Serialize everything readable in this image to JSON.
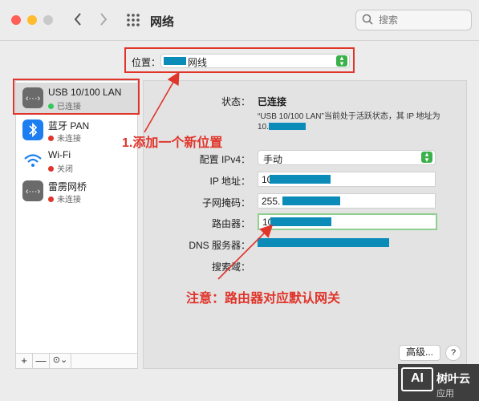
{
  "window": {
    "title": "网络"
  },
  "search": {
    "placeholder": "搜索"
  },
  "location": {
    "label": "位置：",
    "value": "网线"
  },
  "sidebar": {
    "services": [
      {
        "name": "USB 10/100 LAN",
        "status": "已连接",
        "status_color": "#34c759"
      },
      {
        "name": "蓝牙 PAN",
        "status": "未连接",
        "status_color": "#e0352b"
      },
      {
        "name": "Wi-Fi",
        "status": "关闭",
        "status_color": "#e0352b"
      },
      {
        "name": "雷雳网桥",
        "status": "未连接",
        "status_color": "#e0352b"
      }
    ],
    "footer": {
      "add": "+",
      "remove": "—",
      "actions": "⊙⌄"
    }
  },
  "detail": {
    "status_label": "状态：",
    "status_value": "已连接",
    "description": "“USB 10/100 LAN”当前处于活跃状态，其 IP 地址为 10.",
    "configure_label": "配置 IPv4：",
    "configure_value": "手动",
    "ip_label": "IP 地址：",
    "ip_value": "10",
    "subnet_label": "子网掩码：",
    "subnet_value": "255.",
    "router_label": "路由器：",
    "router_value": "10",
    "dns_label": "DNS 服务器：",
    "search_domains_label": "搜索域：",
    "advanced_button": "高级...",
    "help_button": "?"
  },
  "annotations": {
    "step1": "1.添加一个新位置",
    "note": "注意：路由器对应默认网关"
  },
  "watermark": {
    "logo": "AI",
    "text": "树叶云",
    "sub": "应用"
  },
  "colors": {
    "annotation": "#e0352b",
    "redaction": "#0a8bb8",
    "accent_green": "#3bb14a"
  }
}
